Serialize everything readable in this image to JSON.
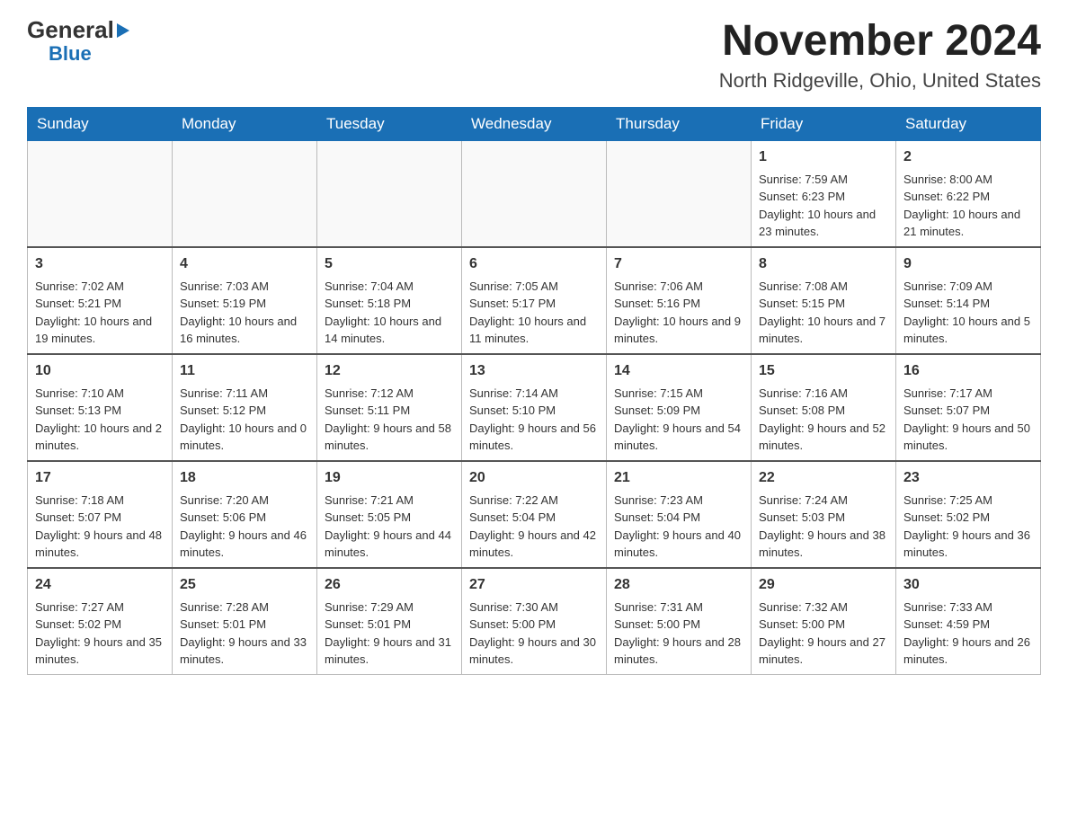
{
  "logo": {
    "general": "General",
    "blue": "Blue",
    "triangle": "▼"
  },
  "title": "November 2024",
  "subtitle": "North Ridgeville, Ohio, United States",
  "days_of_week": [
    "Sunday",
    "Monday",
    "Tuesday",
    "Wednesday",
    "Thursday",
    "Friday",
    "Saturday"
  ],
  "weeks": [
    [
      {
        "day": "",
        "info": ""
      },
      {
        "day": "",
        "info": ""
      },
      {
        "day": "",
        "info": ""
      },
      {
        "day": "",
        "info": ""
      },
      {
        "day": "",
        "info": ""
      },
      {
        "day": "1",
        "sunrise": "Sunrise: 7:59 AM",
        "sunset": "Sunset: 6:23 PM",
        "daylight": "Daylight: 10 hours and 23 minutes."
      },
      {
        "day": "2",
        "sunrise": "Sunrise: 8:00 AM",
        "sunset": "Sunset: 6:22 PM",
        "daylight": "Daylight: 10 hours and 21 minutes."
      }
    ],
    [
      {
        "day": "3",
        "sunrise": "Sunrise: 7:02 AM",
        "sunset": "Sunset: 5:21 PM",
        "daylight": "Daylight: 10 hours and 19 minutes."
      },
      {
        "day": "4",
        "sunrise": "Sunrise: 7:03 AM",
        "sunset": "Sunset: 5:19 PM",
        "daylight": "Daylight: 10 hours and 16 minutes."
      },
      {
        "day": "5",
        "sunrise": "Sunrise: 7:04 AM",
        "sunset": "Sunset: 5:18 PM",
        "daylight": "Daylight: 10 hours and 14 minutes."
      },
      {
        "day": "6",
        "sunrise": "Sunrise: 7:05 AM",
        "sunset": "Sunset: 5:17 PM",
        "daylight": "Daylight: 10 hours and 11 minutes."
      },
      {
        "day": "7",
        "sunrise": "Sunrise: 7:06 AM",
        "sunset": "Sunset: 5:16 PM",
        "daylight": "Daylight: 10 hours and 9 minutes."
      },
      {
        "day": "8",
        "sunrise": "Sunrise: 7:08 AM",
        "sunset": "Sunset: 5:15 PM",
        "daylight": "Daylight: 10 hours and 7 minutes."
      },
      {
        "day": "9",
        "sunrise": "Sunrise: 7:09 AM",
        "sunset": "Sunset: 5:14 PM",
        "daylight": "Daylight: 10 hours and 5 minutes."
      }
    ],
    [
      {
        "day": "10",
        "sunrise": "Sunrise: 7:10 AM",
        "sunset": "Sunset: 5:13 PM",
        "daylight": "Daylight: 10 hours and 2 minutes."
      },
      {
        "day": "11",
        "sunrise": "Sunrise: 7:11 AM",
        "sunset": "Sunset: 5:12 PM",
        "daylight": "Daylight: 10 hours and 0 minutes."
      },
      {
        "day": "12",
        "sunrise": "Sunrise: 7:12 AM",
        "sunset": "Sunset: 5:11 PM",
        "daylight": "Daylight: 9 hours and 58 minutes."
      },
      {
        "day": "13",
        "sunrise": "Sunrise: 7:14 AM",
        "sunset": "Sunset: 5:10 PM",
        "daylight": "Daylight: 9 hours and 56 minutes."
      },
      {
        "day": "14",
        "sunrise": "Sunrise: 7:15 AM",
        "sunset": "Sunset: 5:09 PM",
        "daylight": "Daylight: 9 hours and 54 minutes."
      },
      {
        "day": "15",
        "sunrise": "Sunrise: 7:16 AM",
        "sunset": "Sunset: 5:08 PM",
        "daylight": "Daylight: 9 hours and 52 minutes."
      },
      {
        "day": "16",
        "sunrise": "Sunrise: 7:17 AM",
        "sunset": "Sunset: 5:07 PM",
        "daylight": "Daylight: 9 hours and 50 minutes."
      }
    ],
    [
      {
        "day": "17",
        "sunrise": "Sunrise: 7:18 AM",
        "sunset": "Sunset: 5:07 PM",
        "daylight": "Daylight: 9 hours and 48 minutes."
      },
      {
        "day": "18",
        "sunrise": "Sunrise: 7:20 AM",
        "sunset": "Sunset: 5:06 PM",
        "daylight": "Daylight: 9 hours and 46 minutes."
      },
      {
        "day": "19",
        "sunrise": "Sunrise: 7:21 AM",
        "sunset": "Sunset: 5:05 PM",
        "daylight": "Daylight: 9 hours and 44 minutes."
      },
      {
        "day": "20",
        "sunrise": "Sunrise: 7:22 AM",
        "sunset": "Sunset: 5:04 PM",
        "daylight": "Daylight: 9 hours and 42 minutes."
      },
      {
        "day": "21",
        "sunrise": "Sunrise: 7:23 AM",
        "sunset": "Sunset: 5:04 PM",
        "daylight": "Daylight: 9 hours and 40 minutes."
      },
      {
        "day": "22",
        "sunrise": "Sunrise: 7:24 AM",
        "sunset": "Sunset: 5:03 PM",
        "daylight": "Daylight: 9 hours and 38 minutes."
      },
      {
        "day": "23",
        "sunrise": "Sunrise: 7:25 AM",
        "sunset": "Sunset: 5:02 PM",
        "daylight": "Daylight: 9 hours and 36 minutes."
      }
    ],
    [
      {
        "day": "24",
        "sunrise": "Sunrise: 7:27 AM",
        "sunset": "Sunset: 5:02 PM",
        "daylight": "Daylight: 9 hours and 35 minutes."
      },
      {
        "day": "25",
        "sunrise": "Sunrise: 7:28 AM",
        "sunset": "Sunset: 5:01 PM",
        "daylight": "Daylight: 9 hours and 33 minutes."
      },
      {
        "day": "26",
        "sunrise": "Sunrise: 7:29 AM",
        "sunset": "Sunset: 5:01 PM",
        "daylight": "Daylight: 9 hours and 31 minutes."
      },
      {
        "day": "27",
        "sunrise": "Sunrise: 7:30 AM",
        "sunset": "Sunset: 5:00 PM",
        "daylight": "Daylight: 9 hours and 30 minutes."
      },
      {
        "day": "28",
        "sunrise": "Sunrise: 7:31 AM",
        "sunset": "Sunset: 5:00 PM",
        "daylight": "Daylight: 9 hours and 28 minutes."
      },
      {
        "day": "29",
        "sunrise": "Sunrise: 7:32 AM",
        "sunset": "Sunset: 5:00 PM",
        "daylight": "Daylight: 9 hours and 27 minutes."
      },
      {
        "day": "30",
        "sunrise": "Sunrise: 7:33 AM",
        "sunset": "Sunset: 4:59 PM",
        "daylight": "Daylight: 9 hours and 26 minutes."
      }
    ]
  ]
}
